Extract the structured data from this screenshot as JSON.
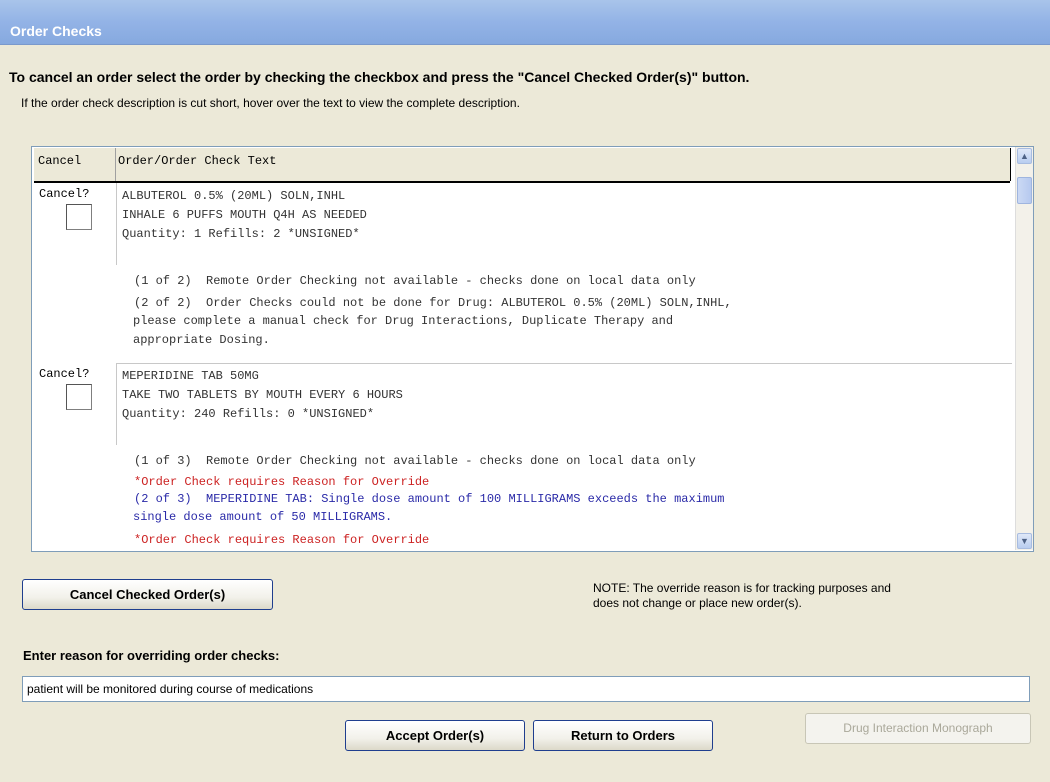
{
  "window": {
    "title": "Order Checks"
  },
  "instructions": {
    "primary": "To cancel an order select the order by checking the checkbox and press the \"Cancel Checked Order(s)\" button.",
    "secondary": "If the order check description is cut short, hover over the text to view the complete description."
  },
  "grid": {
    "columns": [
      "Cancel",
      "Order/Order Check Text"
    ],
    "cancel_label": "Cancel?",
    "orders": [
      {
        "lines": [
          "ALBUTEROL 0.5% (20ML) SOLN,INHL",
          "INHALE 6 PUFFS MOUTH Q4H AS NEEDED",
          "Quantity: 1 Refills: 2 *UNSIGNED*"
        ],
        "checked": false,
        "checks": [
          {
            "text": "(1 of 2)  Remote Order Checking not available - checks done on local data only",
            "color": "#333333"
          },
          {
            "text": "(2 of 2)  Order Checks could not be done for Drug: ALBUTEROL 0.5% (20ML) SOLN,INHL,",
            "color": "#333333"
          },
          {
            "text": "please complete a manual check for Drug Interactions, Duplicate Therapy and",
            "color": "#333333"
          },
          {
            "text": "appropriate Dosing.",
            "color": "#333333"
          }
        ]
      },
      {
        "lines": [
          "MEPERIDINE TAB 50MG",
          "TAKE TWO TABLETS BY MOUTH EVERY 6 HOURS",
          "Quantity: 240 Refills: 0 *UNSIGNED*"
        ],
        "checked": false,
        "checks": [
          {
            "text": "(1 of 3)  Remote Order Checking not available - checks done on local data only",
            "color": "#333333"
          },
          {
            "text": "*Order Check requires Reason for Override",
            "color": "#cc2222"
          },
          {
            "text": "(2 of 3)  MEPERIDINE TAB: Single dose amount of 100 MILLIGRAMS exceeds the maximum",
            "color": "#2a2aa8"
          },
          {
            "text": "single dose amount of 50 MILLIGRAMS.",
            "color": "#2a2aa8"
          },
          {
            "text": "*Order Check requires Reason for Override",
            "color": "#cc2222"
          }
        ]
      }
    ]
  },
  "buttons": {
    "cancel_checked": "Cancel Checked Order(s)",
    "accept": "Accept Order(s)",
    "return": "Return to Orders",
    "monograph": "Drug Interaction Monograph"
  },
  "note": {
    "line1": "NOTE: The override reason is for tracking purposes and",
    "line2": "does not change or place new order(s)."
  },
  "override": {
    "label": "Enter reason for overriding order checks:",
    "value": "patient will be monitored during course of medications"
  },
  "icons": {
    "scroll_up": "scroll-up-arrow-icon",
    "scroll_down": "scroll-down-arrow-icon"
  }
}
